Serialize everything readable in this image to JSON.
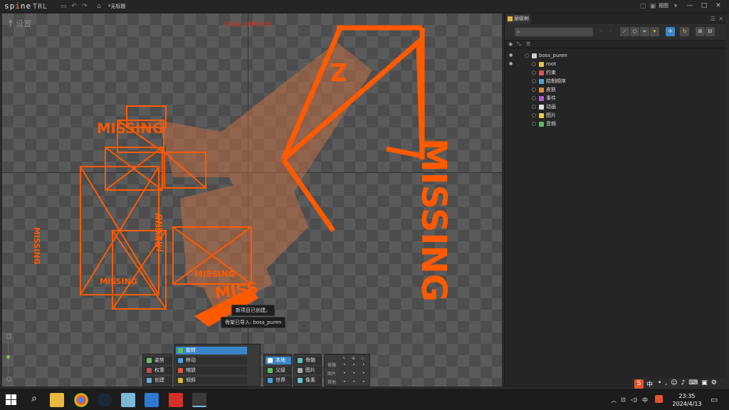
{
  "app": {
    "logo_prefix": "sp",
    "logo_mark": "i",
    "logo_suffix": "ne",
    "edition": "TRL",
    "doc_title": "*无标题",
    "view_label": "视图"
  },
  "viewport": {
    "settings_label": "设置",
    "trial_text": "TRIAL VERSION",
    "toasts": [
      "新项目已创建。",
      "骨架已导入: boss_puren"
    ],
    "missing_labels": [
      "MISSING",
      "MISSING",
      "MISSING",
      "MISSING",
      "MISSING",
      "MISSING"
    ]
  },
  "tools": {
    "left": [
      "姿势",
      "权重",
      "创建"
    ],
    "transform": [
      "旋转",
      "移动",
      "缩放",
      "倾斜"
    ],
    "axes": [
      "本地",
      "父级",
      "世界"
    ],
    "options": [
      "骨骼",
      "图片",
      "像素"
    ],
    "compensate": {
      "rows": [
        "骨骼",
        "图片",
        "其他"
      ]
    }
  },
  "panel": {
    "tab_label": "层级树",
    "tree": [
      {
        "label": "boss_puren",
        "indent": 0,
        "icon": "skeleton-icon",
        "color": "#cccccc",
        "eye": true
      },
      {
        "label": "root",
        "indent": 1,
        "icon": "bone-icon",
        "color": "#f0c040",
        "eye": true
      },
      {
        "label": "约束",
        "indent": 1,
        "icon": "constraint-icon",
        "color": "#e35050",
        "eye": false
      },
      {
        "label": "绘制顺序",
        "indent": 1,
        "icon": "draw-order-icon",
        "color": "#4aa3df",
        "eye": false
      },
      {
        "label": "皮肤",
        "indent": 1,
        "icon": "skin-icon",
        "color": "#e2833b",
        "eye": false
      },
      {
        "label": "事件",
        "indent": 1,
        "icon": "event-icon",
        "color": "#b05ad8",
        "eye": false
      },
      {
        "label": "动画",
        "indent": 1,
        "icon": "animation-icon",
        "color": "#dddddd",
        "eye": false
      },
      {
        "label": "图片",
        "indent": 1,
        "icon": "images-icon",
        "color": "#e8c94a",
        "eye": false
      },
      {
        "label": "音频",
        "indent": 1,
        "icon": "audio-icon",
        "color": "#5bbf5b",
        "eye": false
      }
    ]
  },
  "taskbar": {
    "time": "23:35",
    "date": "2024/4/13",
    "ime": "中",
    "lang": "中"
  },
  "colors": {
    "accent": "#3a85c7",
    "missing": "#ff5a00",
    "trial": "#d6331d"
  }
}
